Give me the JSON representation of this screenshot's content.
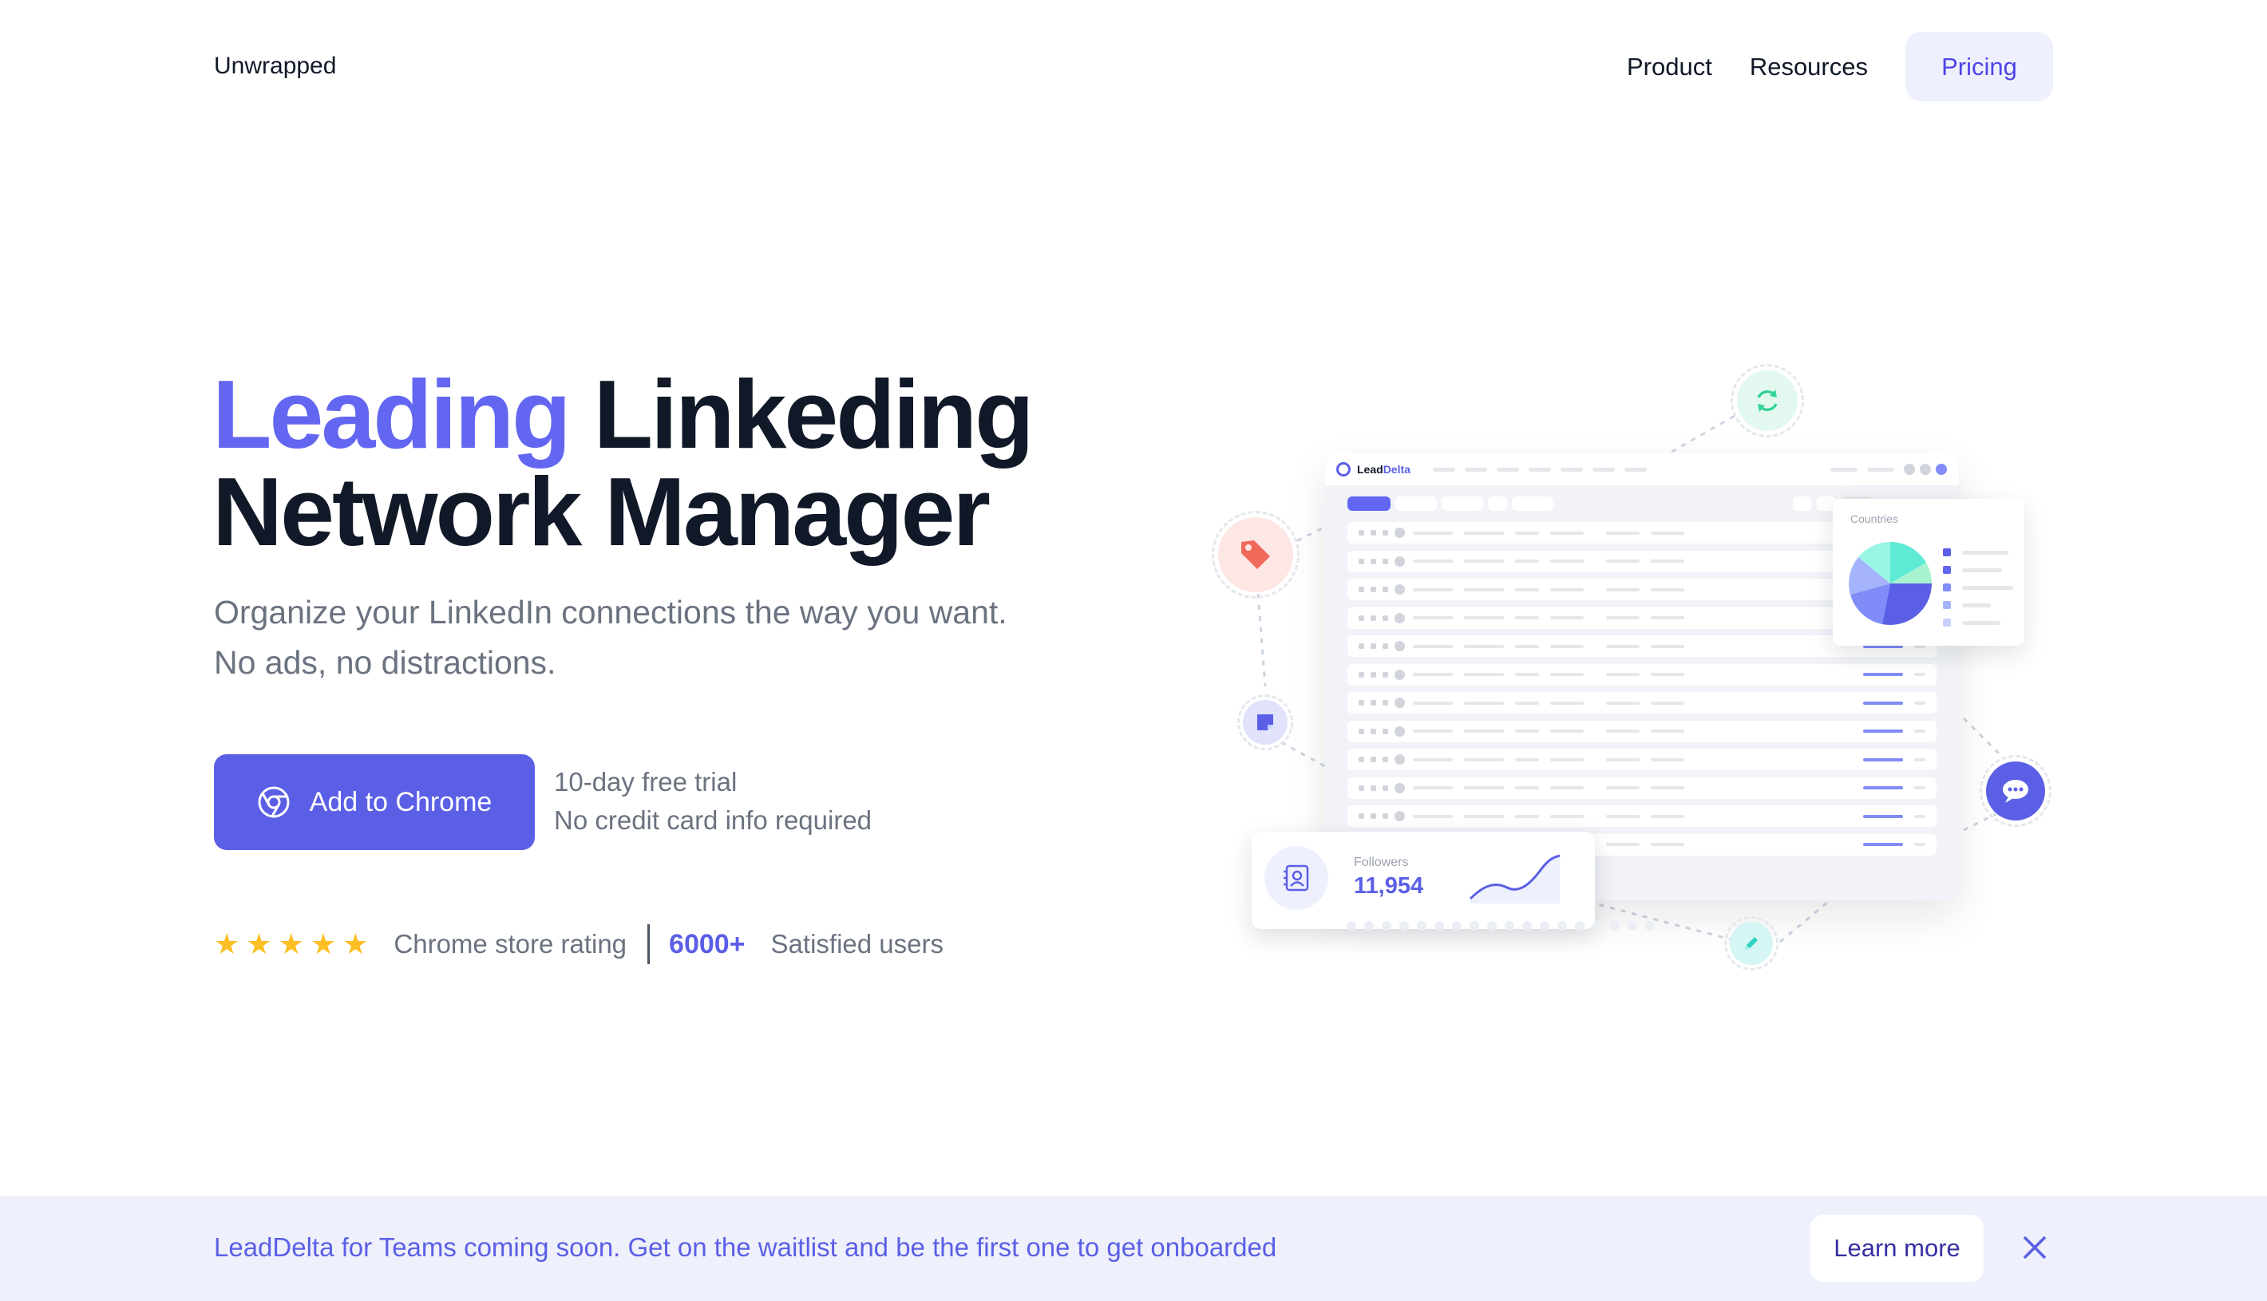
{
  "header": {
    "logo": "Unwrapped",
    "nav": {
      "product": "Product",
      "resources": "Resources",
      "pricing": "Pricing"
    }
  },
  "hero": {
    "headline_accent": "Leading",
    "headline_rest": "Linkeding",
    "headline_line2": "Network Manager",
    "subtitle": "Organize your LinkedIn connections the way you want. No ads, no distractions.",
    "cta_label": "Add to Chrome",
    "trial_line1": "10-day free trial",
    "trial_line2": "No credit card info required",
    "rating_label": "Chrome store rating",
    "stars": 5,
    "users_count": "6000+",
    "users_label": "Satisfied users"
  },
  "illustration": {
    "app_brand_prefix": "Lead",
    "app_brand_suffix": "Delta",
    "countries_title": "Countries",
    "followers_label": "Followers",
    "followers_value": "11,954",
    "colors": {
      "accent": "#6366f1",
      "teal": "#5eead4",
      "tag_red": "#ef6a5a",
      "sync_green": "#34d399"
    }
  },
  "banner": {
    "text": "LeadDelta for Teams coming soon. Get on the waitlist and be the first one to get onboarded",
    "learn_more": "Learn more"
  },
  "icons": [
    "chrome-icon",
    "star-icon",
    "sync-icon",
    "tag-icon",
    "note-icon",
    "chat-icon",
    "contacts-icon",
    "pencil-icon",
    "close-icon"
  ]
}
